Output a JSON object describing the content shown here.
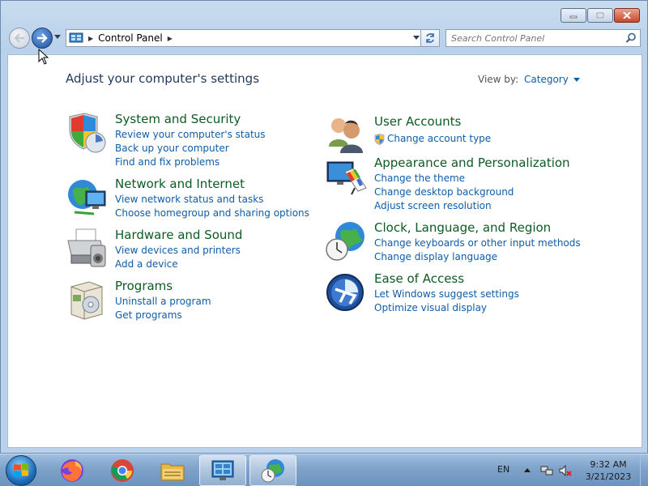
{
  "window": {
    "breadcrumb": "Control Panel",
    "search_placeholder": "Search Control Panel"
  },
  "page": {
    "title": "Adjust your computer's settings",
    "viewby_label": "View by:",
    "viewby_value": "Category"
  },
  "categories": [
    {
      "title": "System and Security",
      "links": [
        "Review your computer's status",
        "Back up your computer",
        "Find and fix problems"
      ]
    },
    {
      "title": "Network and Internet",
      "links": [
        "View network status and tasks",
        "Choose homegroup and sharing options"
      ]
    },
    {
      "title": "Hardware and Sound",
      "links": [
        "View devices and printers",
        "Add a device"
      ]
    },
    {
      "title": "Programs",
      "links": [
        "Uninstall a program",
        "Get programs"
      ]
    },
    {
      "title": "User Accounts",
      "links": [
        "Change account type"
      ]
    },
    {
      "title": "Appearance and Personalization",
      "links": [
        "Change the theme",
        "Change desktop background",
        "Adjust screen resolution"
      ]
    },
    {
      "title": "Clock, Language, and Region",
      "links": [
        "Change keyboards or other input methods",
        "Change display language"
      ]
    },
    {
      "title": "Ease of Access",
      "links": [
        "Let Windows suggest settings",
        "Optimize visual display"
      ]
    }
  ],
  "taskbar": {
    "items": [
      "firefox-icon",
      "chrome-icon",
      "file-explorer-icon",
      "control-panel-icon",
      "clock-region-icon"
    ],
    "lang": "EN",
    "time": "9:32 AM",
    "date": "3/21/2023"
  },
  "colors": {
    "link": "#0f5da8",
    "category_title": "#0d5b23",
    "title": "#1e395b"
  }
}
